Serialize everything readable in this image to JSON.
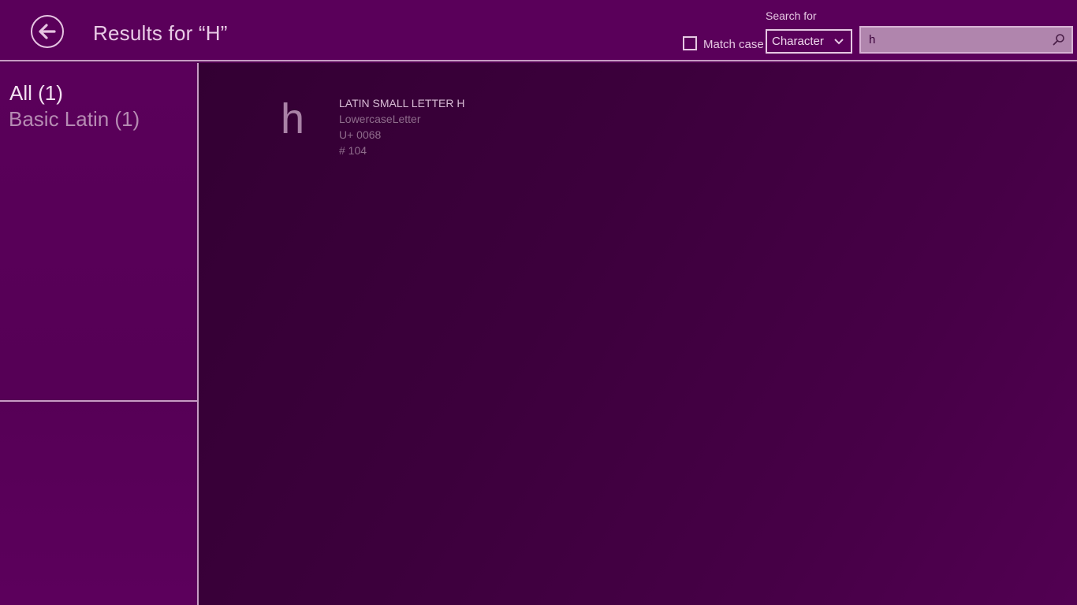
{
  "header": {
    "title": "Results for “H”",
    "search_for_label": "Search for",
    "match_case_label": "Match case",
    "match_case_checked": false,
    "search_type_value": "Character",
    "search_query": "h",
    "icons": {
      "back": "back-arrow-icon",
      "dropdown": "chevron-down-icon",
      "search": "search-icon"
    }
  },
  "filters": [
    {
      "label": "All (1)",
      "selected": true
    },
    {
      "label": "Basic Latin (1)",
      "selected": false
    }
  ],
  "results": [
    {
      "glyph": "h",
      "name": "LATIN SMALL LETTER H",
      "category": "LowercaseLetter",
      "codepoint": "U+ 0068",
      "decimal": "# 104"
    }
  ],
  "colors": {
    "header_background": "#5a005a",
    "divider": "#c79cc4",
    "main_background_dark": "#330033",
    "search_box_fill": "#b085ad"
  }
}
